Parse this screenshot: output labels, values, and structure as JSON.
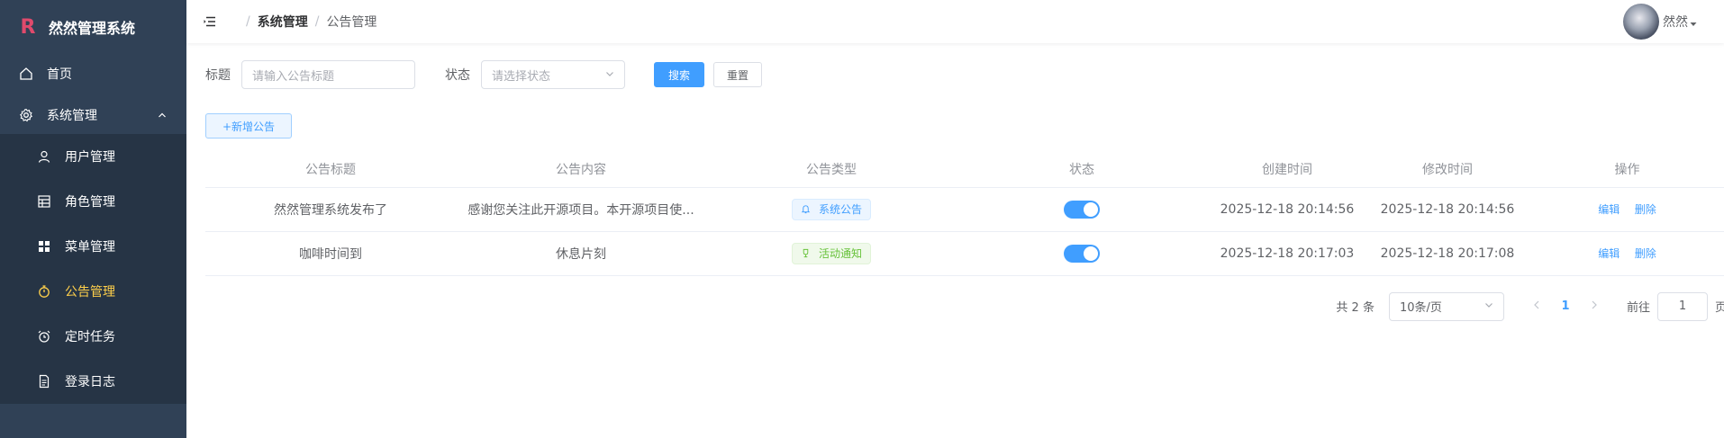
{
  "sidebar": {
    "logo_letter": "R",
    "title": "然然管理系统",
    "items": [
      {
        "label": "首页",
        "icon": "home-icon"
      },
      {
        "label": "系统管理",
        "icon": "gear-icon"
      },
      {
        "label": "用户管理",
        "icon": "user-icon"
      },
      {
        "label": "角色管理",
        "icon": "grid-icon"
      },
      {
        "label": "菜单管理",
        "icon": "menu-icon"
      },
      {
        "label": "公告管理",
        "icon": "stopwatch-icon"
      },
      {
        "label": "定时任务",
        "icon": "alarm-clock-icon"
      },
      {
        "label": "登录日志",
        "icon": "document-icon"
      }
    ]
  },
  "header": {
    "breadcrumb": [
      "系统管理",
      "公告管理"
    ],
    "separator": "/",
    "username": "然然"
  },
  "search": {
    "title_label": "标题",
    "title_placeholder": "请输入公告标题",
    "status_label": "状态",
    "status_placeholder": "请选择状态",
    "search_button": "搜索",
    "reset_button": "重置"
  },
  "toolbar": {
    "add_button": "+新增公告"
  },
  "table": {
    "headers": [
      "公告标题",
      "公告内容",
      "公告类型",
      "状态",
      "创建时间",
      "修改时间",
      "操作"
    ],
    "rows": [
      {
        "title": "然然管理系统发布了",
        "content": "感谢您关注此开源项目。本开源项目使...",
        "type": "系统公告",
        "status_on": true,
        "created": "2025-12-18 20:14:56",
        "updated": "2025-12-18 20:14:56",
        "edit": "编辑",
        "delete": "删除"
      },
      {
        "title": "咖啡时间到",
        "content": "休息片刻",
        "type": "活动通知",
        "status_on": true,
        "created": "2025-12-18 20:17:03",
        "updated": "2025-12-18 20:17:08",
        "edit": "编辑",
        "delete": "删除"
      }
    ]
  },
  "pagination": {
    "total": "共 2 条",
    "page_size": "10条/页",
    "current_page": "1",
    "goto_label": "前往",
    "goto_value": "1",
    "page_suffix": "页"
  },
  "colors": {
    "sidebar_bg": "#304156",
    "active_menu": "#ffd04b",
    "primary": "#409eff",
    "success": "#67c23a"
  }
}
